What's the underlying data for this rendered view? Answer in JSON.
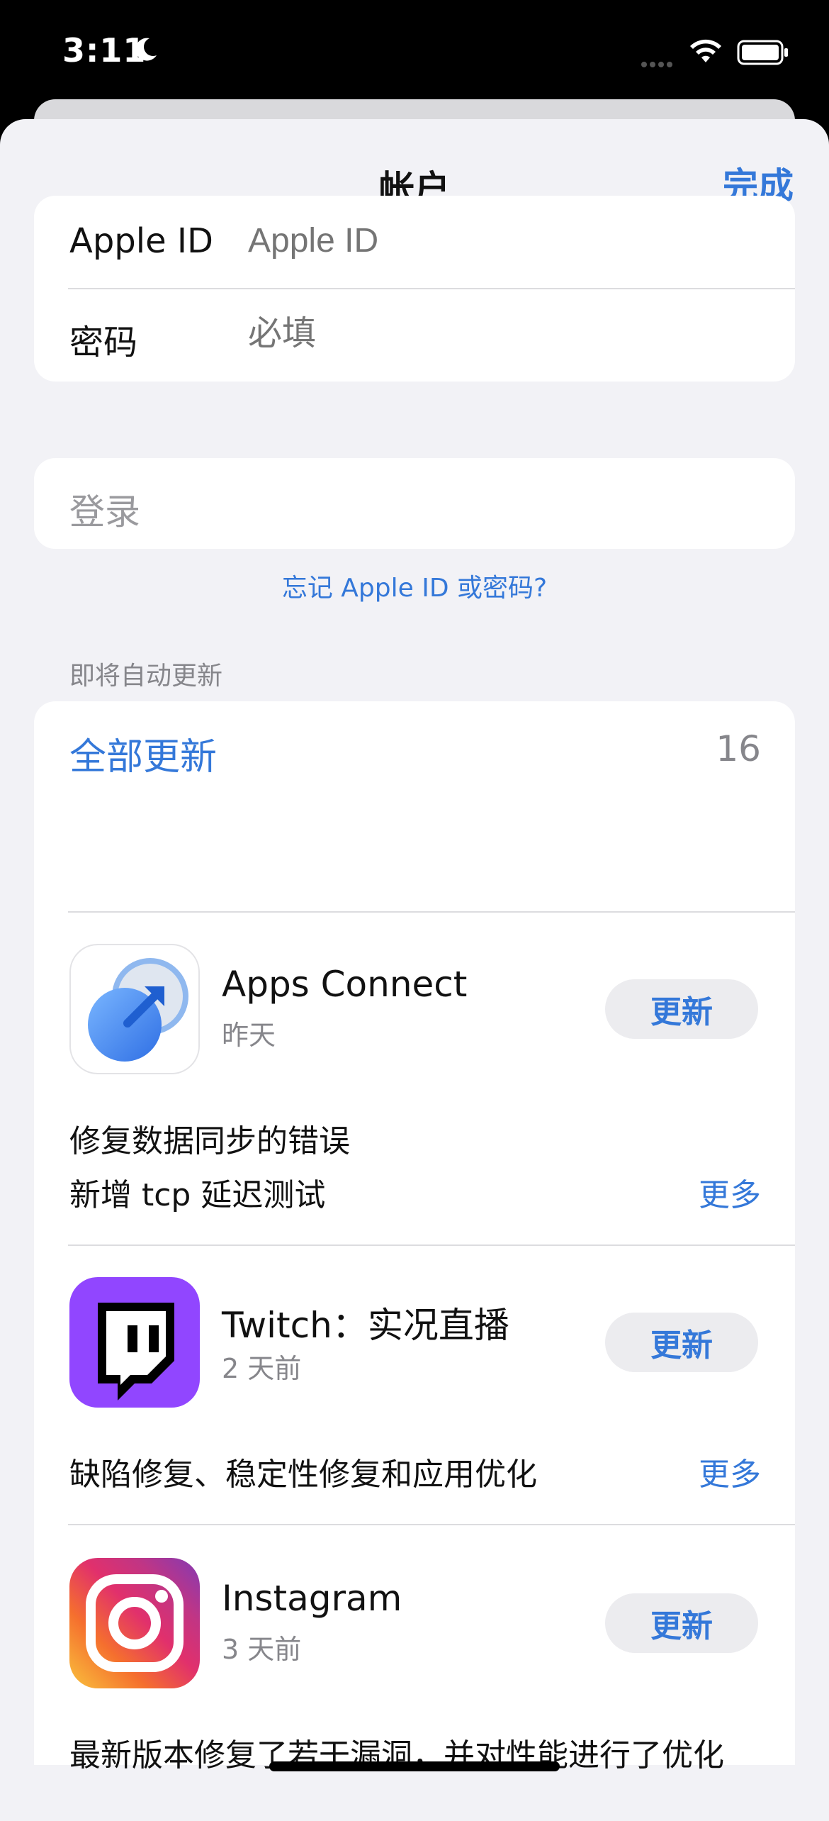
{
  "status_bar": {
    "time": "3:11"
  },
  "nav": {
    "title": "帐户",
    "done_label": "完成"
  },
  "form": {
    "apple_id_label": "Apple ID",
    "apple_id_placeholder": "Apple ID",
    "password_label": "密码",
    "password_placeholder": "必填"
  },
  "login": {
    "label": "登录",
    "forgot_link": "忘记 Apple ID 或密码?"
  },
  "updates": {
    "section_header": "即将自动更新",
    "update_all_label": "全部更新",
    "count": "16",
    "update_button_label": "更新",
    "more_label": "更多",
    "apps": [
      {
        "name": "Apps Connect",
        "date": "昨天",
        "notes": [
          "修复数据同步的错误",
          "新增 tcp 延迟测试"
        ]
      },
      {
        "name": "Twitch：实况直播",
        "date": "2 天前",
        "notes": [
          "缺陷修复、稳定性修复和应用优化"
        ]
      },
      {
        "name": "Instagram",
        "date": "3 天前",
        "notes": [
          "最新版本修复了若干漏洞，并对性能进行了优化"
        ]
      }
    ]
  },
  "colors": {
    "accent": "#3478d9",
    "background": "#f2f2f6",
    "twitch": "#9146ff"
  }
}
